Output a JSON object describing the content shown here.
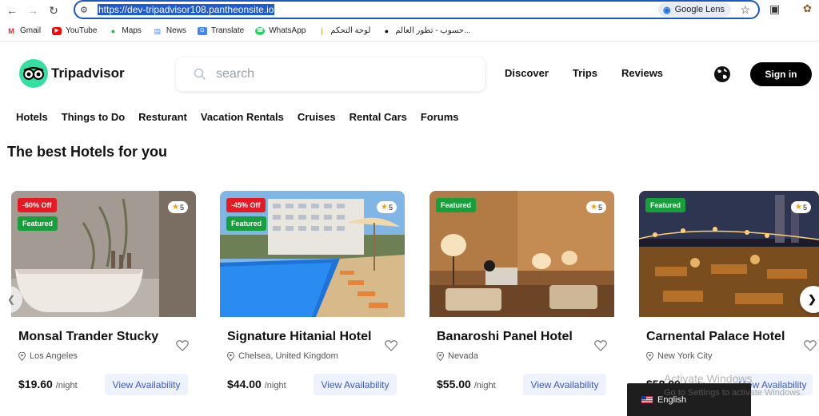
{
  "browser": {
    "url": "https://dev-tripadvisor108.pantheonsite.io",
    "lens_label": "Google Lens",
    "bookmarks": [
      {
        "label": "Gmail",
        "icon": "gmail-icon"
      },
      {
        "label": "YouTube",
        "icon": "youtube-icon"
      },
      {
        "label": "Maps",
        "icon": "maps-icon"
      },
      {
        "label": "News",
        "icon": "news-icon"
      },
      {
        "label": "Translate",
        "icon": "translate-icon"
      },
      {
        "label": "WhatsApp",
        "icon": "whatsapp-icon"
      },
      {
        "label": "لوحة التحكم",
        "icon": "dashboard-icon"
      },
      {
        "label": "حسوب - تطور العالم...",
        "icon": "hsoub-icon"
      }
    ]
  },
  "site": {
    "brand": "Tripadvisor",
    "search_placeholder": "search",
    "topnav": [
      "Discover",
      "Trips",
      "Reviews"
    ],
    "signin_label": "Sign in",
    "categories": [
      "Hotels",
      "Things to Do",
      "Resturant",
      "Vacation Rentals",
      "Cruises",
      "Rental Cars",
      "Forums"
    ],
    "section_title": "The best Hotels for you"
  },
  "hotels": [
    {
      "title": "Monsal Trander Stucky",
      "location": "Los Angeles",
      "price": "$19.60",
      "per": "/night",
      "discount": "-60% Off",
      "featured": "Featured",
      "rating": "5",
      "cta": "View Availability"
    },
    {
      "title": "Signature Hitanial Hotel",
      "location": "Chelsea, United Kingdom",
      "price": "$44.00",
      "per": "/night",
      "discount": "-45% Off",
      "featured": "Featured",
      "rating": "5",
      "cta": "View Availability"
    },
    {
      "title": "Banaroshi Panel Hotel",
      "location": "Nevada",
      "price": "$55.00",
      "per": "/night",
      "discount": "",
      "featured": "Featured",
      "rating": "5",
      "cta": "View Availability"
    },
    {
      "title": "Carnental Palace Hotel",
      "location": "New York City",
      "price": "$58.00",
      "per": "/night",
      "discount": "",
      "featured": "Featured",
      "rating": "5",
      "cta": "View Availability"
    }
  ],
  "language": "English",
  "watermark": {
    "line1": "Activate Windows",
    "line2": "Go to Settings to activate Windows."
  },
  "colors": {
    "accent": "#34e0a1",
    "discount": "#e51b23",
    "featured": "#169f3a",
    "link": "#3b5bcc"
  }
}
